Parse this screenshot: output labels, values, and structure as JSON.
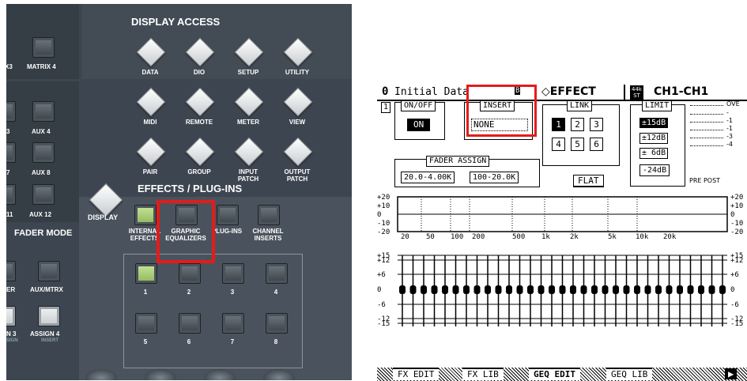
{
  "console": {
    "display_access": {
      "title": "DISPLAY ACCESS",
      "buttons": [
        "DATA",
        "DIO",
        "SETUP",
        "UTILITY",
        "MIDI",
        "REMOTE",
        "METER",
        "VIEW",
        "PAIR",
        "GROUP",
        "INPUT\nPATCH",
        "OUTPUT\nPATCH"
      ]
    },
    "effects": {
      "title": "EFFECTS / PLUG-INS",
      "display_label": "DISPLAY",
      "buttons": [
        "INTERNAL\nEFFECTS",
        "GRAPHIC\nEQUALIZERS",
        "PLUG-INS",
        "CHANNEL\nINSERTS"
      ],
      "numbers": [
        "1",
        "2",
        "3",
        "4",
        "5",
        "6",
        "7",
        "8"
      ]
    },
    "left_col": {
      "matrix4": "MATRIX 4",
      "x3": "X3",
      "aux4": "AUX 4",
      "aux8": "AUX 8",
      "aux12": "AUX 12",
      "n3": "3",
      "n7": "7",
      "n11": "11",
      "fader_mode": "FADER MODE",
      "er": "ER",
      "aux_mtrx": "AUX/MTRX",
      "n3b": "N 3",
      "assign4": "ASSIGN 4",
      "sign": "SIGN",
      "insert": "INSERT"
    }
  },
  "lcd": {
    "scene_no": "0",
    "scene_name": "Initial Data",
    "scene_icon": "B",
    "page_title": "EFFECT",
    "rate_top": "44k",
    "rate_bottom": "ST",
    "channel": "CH1-CH1",
    "geq_number": "1",
    "onoff_label": "ON/OFF",
    "onoff_value": "ON",
    "insert_label": "INSERT",
    "insert_value": "NONE",
    "link_label": "LINK",
    "link_buttons": [
      "1",
      "2",
      "3",
      "4",
      "5",
      "6"
    ],
    "limit_label": "LIMIT",
    "limit_options": [
      "±15dB",
      "±12dB",
      "± 6dB",
      "-24dB"
    ],
    "meter_labels": [
      "OVE",
      "-",
      "-1",
      "-1",
      "-3",
      "-4"
    ],
    "pre_post": "PRE POST",
    "fader_assign_label": "FADER ASSIGN",
    "fader_assign_buttons": [
      "20.0-4.00K",
      "100-20.0K"
    ],
    "flat_label": "FLAT",
    "graph_y_left": [
      "+20",
      "+10",
      "0",
      "-10",
      "-20"
    ],
    "graph_y_right": [
      "+20",
      "+10",
      "0",
      "-10",
      "-20"
    ],
    "graph_x": [
      "20",
      "50",
      "100",
      "200",
      "500",
      "1k",
      "2k",
      "5k",
      "10k",
      "20k"
    ],
    "fader_scale_left": [
      "+15",
      "+12",
      "+6",
      "0",
      "-6",
      "-12",
      "-15"
    ],
    "fader_scale_right": [
      "+15",
      "+12",
      "+6",
      "0",
      "-6",
      "-12",
      "-15"
    ],
    "fader_count": 31,
    "tabs": [
      "FX EDIT",
      "FX LIB",
      "GEQ EDIT",
      "GEQ LIB"
    ],
    "active_tab": "GEQ EDIT"
  },
  "colors": {
    "highlight": "#e41b1b",
    "panel": "#3d4650",
    "lcd_ink": "#000000"
  }
}
